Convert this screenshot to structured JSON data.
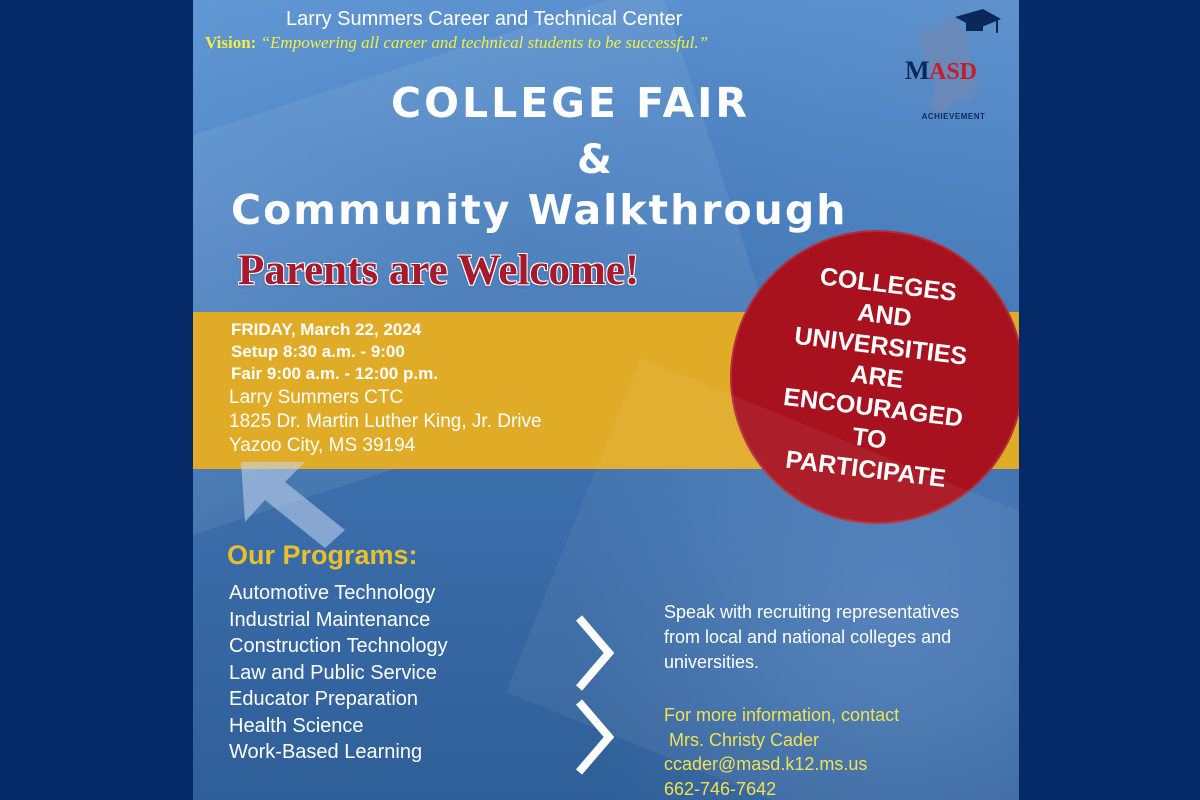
{
  "header": {
    "title": "Larry Summers Career and Technical Center",
    "vision_label": "Vision:",
    "vision_text": "“Empowering all career and technical students to be successful.”"
  },
  "title": {
    "line1": "COLLEGE FAIR",
    "ampersand": "&",
    "line2": "Community Walkthrough"
  },
  "welcome": "Parents are Welcome!",
  "event": {
    "date": "FRIDAY, March 22, 2024",
    "setup": "Setup 8:30 a.m. - 9:00",
    "fair": "Fair  9:00 a.m. - 12:00 p.m.",
    "venue": "Larry Summers CTC",
    "street": "1825 Dr. Martin Luther King,  Jr. Drive",
    "city": "Yazoo City, MS  39194"
  },
  "callout": {
    "lines": [
      "COLLEGES",
      "AND",
      "UNIVERSITIES",
      "ARE",
      "ENCOURAGED",
      "TO",
      "PARTICIPATE"
    ]
  },
  "programs": {
    "title": "Our Programs:",
    "items": [
      "Automotive Technology",
      "Industrial Maintenance",
      "Construction Technology",
      "Law and Public Service",
      "Educator Preparation",
      "Health Science",
      "Work-Based Learning"
    ]
  },
  "speak": "Speak with recruiting representatives from local and national colleges and universities.",
  "contact": {
    "intro": "For more information, contact",
    "name": "Mrs. Christy Cader",
    "email": "ccader@masd.k12.ms.us",
    "phone": "662-746-7642"
  },
  "logo": {
    "text_m": "M",
    "text_asd": "ASD",
    "label": "ACHIEVEMENT"
  },
  "icons": {
    "chevron": "chevron-right-icon",
    "arrow": "arrow-left-icon",
    "logo": "masd-logo"
  },
  "colors": {
    "background": "#062a68",
    "poster": "#4c86c8",
    "banner": "#e0ac28",
    "callout": "#a8121f",
    "welcome": "#a8192d",
    "accent_yellow": "#f0e14a"
  }
}
